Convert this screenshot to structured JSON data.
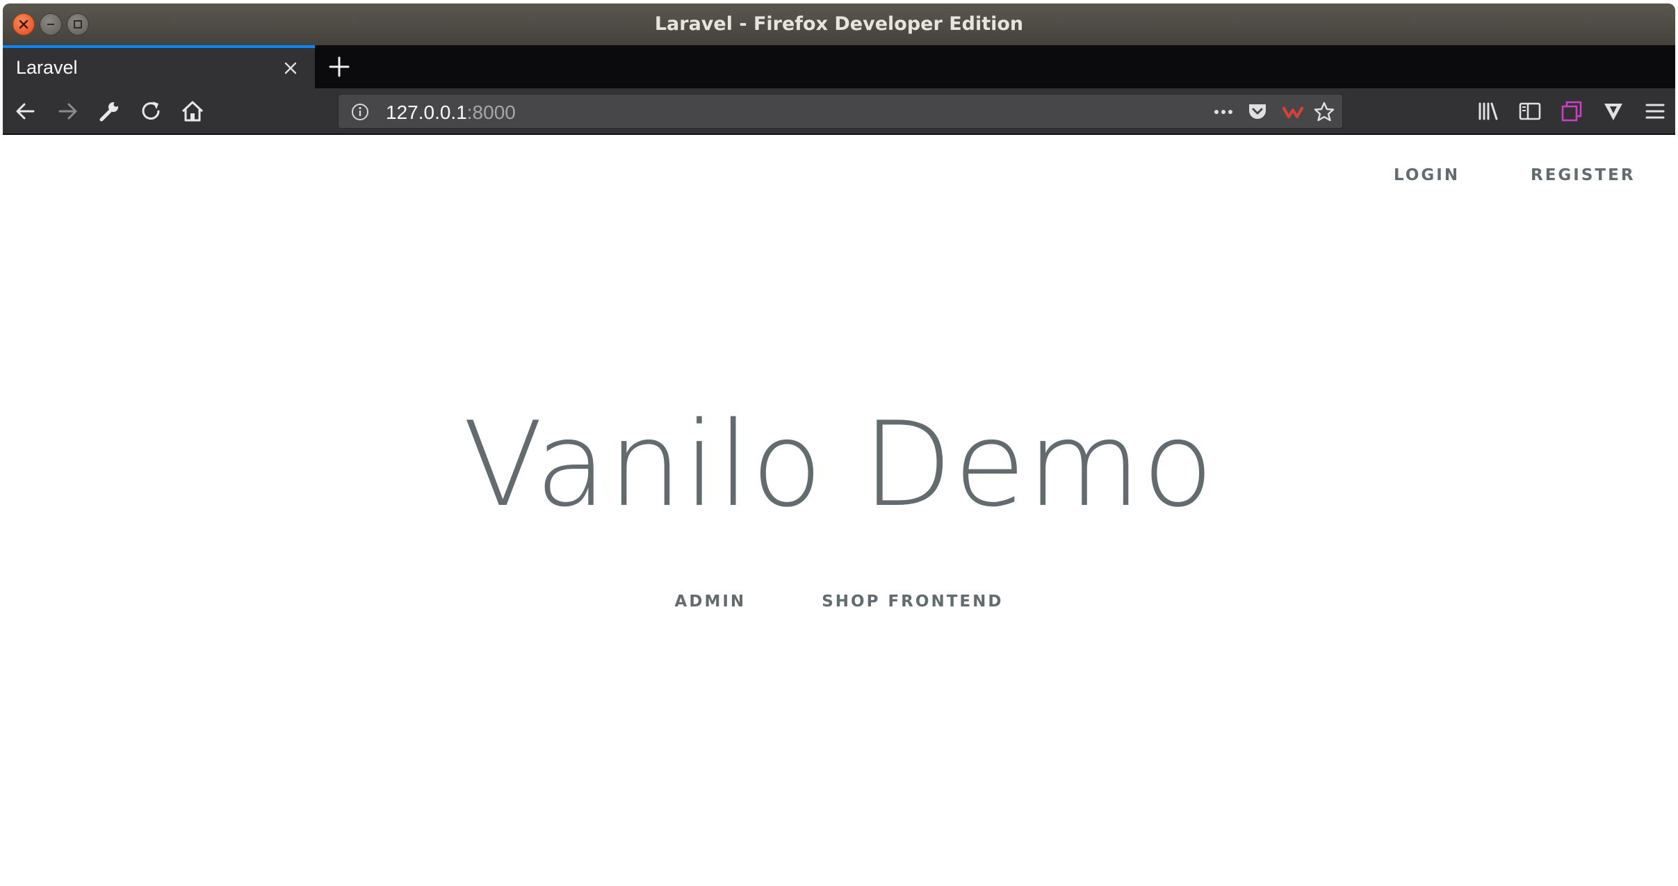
{
  "window": {
    "title": "Laravel - Firefox Developer Edition"
  },
  "tabs": [
    {
      "label": "Laravel",
      "active": true
    }
  ],
  "toolbar": {
    "back_icon": "arrow-left-icon",
    "forward_icon": "arrow-right-icon",
    "tools_icon": "wrench-icon",
    "reload_icon": "reload-icon",
    "home_icon": "home-icon"
  },
  "urlbar": {
    "host": "127.0.0.1",
    "port": ":8000"
  },
  "page": {
    "nav": {
      "login": "LOGIN",
      "register": "REGISTER"
    },
    "title": "Vanilo Demo",
    "links": {
      "admin": "ADMIN",
      "shop": "SHOP FRONTEND"
    }
  },
  "colors": {
    "accent": "#0a84ff",
    "text": "#636b6f",
    "chrome_dark": "#323234"
  }
}
